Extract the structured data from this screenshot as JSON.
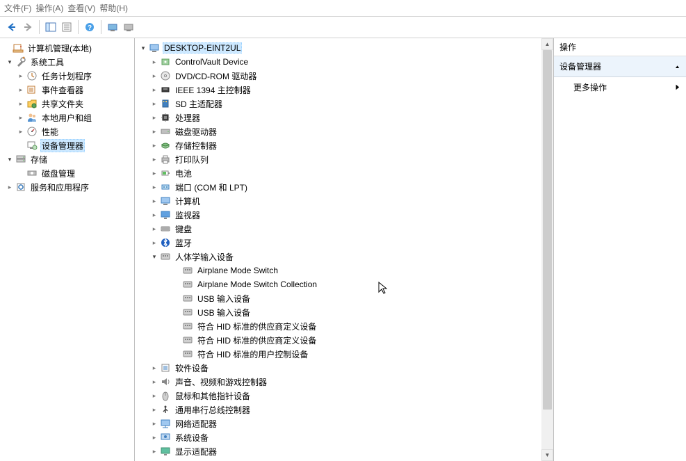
{
  "menubar": {
    "file": "文件(F)",
    "action": "操作(A)",
    "view": "查看(V)",
    "help": "帮助(H)"
  },
  "left_tree": {
    "root": "计算机管理(本地)",
    "system_tools": "系统工具",
    "task_scheduler": "任务计划程序",
    "event_viewer": "事件查看器",
    "shared_folders": "共享文件夹",
    "local_users": "本地用户和组",
    "performance": "性能",
    "device_manager": "设备管理器",
    "storage": "存储",
    "disk_management": "磁盘管理",
    "services_apps": "服务和应用程序"
  },
  "device_tree": {
    "root": "DESKTOP-EINT2UL",
    "categories": [
      {
        "label": "ControlVault Device",
        "icon": "sensor"
      },
      {
        "label": "DVD/CD-ROM 驱动器",
        "icon": "disc"
      },
      {
        "label": "IEEE 1394 主控制器",
        "icon": "firewire"
      },
      {
        "label": "SD 主适配器",
        "icon": "sd"
      },
      {
        "label": "处理器",
        "icon": "cpu"
      },
      {
        "label": "磁盘驱动器",
        "icon": "hdd"
      },
      {
        "label": "存储控制器",
        "icon": "storage"
      },
      {
        "label": "打印队列",
        "icon": "printer"
      },
      {
        "label": "电池",
        "icon": "battery"
      },
      {
        "label": "端口 (COM 和 LPT)",
        "icon": "port"
      },
      {
        "label": "计算机",
        "icon": "computer"
      },
      {
        "label": "监视器",
        "icon": "monitor"
      },
      {
        "label": "键盘",
        "icon": "keyboard"
      },
      {
        "label": "蓝牙",
        "icon": "bluetooth"
      }
    ],
    "hid": {
      "label": "人体学输入设备",
      "children": [
        "Airplane Mode Switch",
        "Airplane Mode Switch Collection",
        "USB 输入设备",
        "USB 输入设备",
        "符合 HID 标准的供应商定义设备",
        "符合 HID 标准的供应商定义设备",
        "符合 HID 标准的用户控制设备"
      ]
    },
    "categories2": [
      {
        "label": "软件设备",
        "icon": "software"
      },
      {
        "label": "声音、视频和游戏控制器",
        "icon": "audio"
      },
      {
        "label": "鼠标和其他指针设备",
        "icon": "mouse"
      },
      {
        "label": "通用串行总线控制器",
        "icon": "usb"
      },
      {
        "label": "网络适配器",
        "icon": "network"
      },
      {
        "label": "系统设备",
        "icon": "system"
      },
      {
        "label": "显示适配器",
        "icon": "display"
      }
    ]
  },
  "actions": {
    "header": "操作",
    "sub": "设备管理器",
    "more": "更多操作"
  }
}
